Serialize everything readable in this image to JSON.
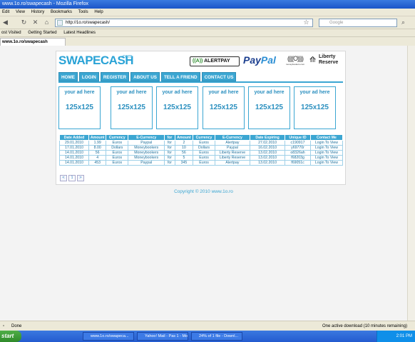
{
  "window": {
    "title": "www.1o.ro/swapecash - Mozilla Firefox"
  },
  "menu": [
    "Edit",
    "View",
    "History",
    "Bookmarks",
    "Tools",
    "Help"
  ],
  "toolbar": {
    "url": "http://1o.ro/swapecash/",
    "search_placeholder": "Google"
  },
  "bookmarks": [
    "ost Visited",
    "Getting Started",
    "Latest Headlines"
  ],
  "tab": {
    "label": "www.1o.ro/swapecash"
  },
  "page": {
    "logo": "SWAPECASH",
    "logo_suffix": ".com",
    "payments": {
      "alertpay_a": "((A))",
      "alertpay_b": "ALERTPAY",
      "paypal_a": "Pay",
      "paypal_b": "Pal",
      "moneybookers": "((((O))))",
      "moneybookers_sub": "moneybookers.com",
      "lr_icon": "⟰",
      "liberty_reserve": "Liberty Reserve"
    },
    "nav": [
      "HOME",
      "LOGIN",
      "REGISTER",
      "ABOUT US",
      "TELL A FRIEND",
      "CONTACT US"
    ],
    "ads": [
      {
        "line1": "your ad here",
        "line2": "125x125"
      },
      {
        "line1": "your ad here",
        "line2": "125x125"
      },
      {
        "line1": "your ad here",
        "line2": "125x125"
      },
      {
        "line1": "your ad here",
        "line2": "125x125"
      },
      {
        "line1": "your ad here",
        "line2": "125x125"
      },
      {
        "line1": "your ad here",
        "line2": "125x125"
      }
    ],
    "table": {
      "headers": [
        "Date Added",
        "Amount",
        "Currency",
        "E-Currency",
        "for",
        "Amount",
        "Currency",
        "E-Currency",
        "Date Expiring",
        "Unique ID",
        "Contact Me"
      ],
      "rows": [
        [
          "29.01.2010",
          "1.99",
          "Euros",
          "Paypal",
          "for",
          "2",
          "Euros",
          "Alertpay",
          "27.02.2010",
          "c190917",
          "Login To View"
        ],
        [
          "17.01.2010",
          "8.00",
          "Dollars",
          "Moneybookers",
          "for",
          "10",
          "Dollars",
          "Paypal",
          "16.02.2010",
          "y69770r",
          "Login To View"
        ],
        [
          "14.01.2010",
          "56",
          "Euros",
          "Moneybookers",
          "for",
          "56",
          "Euros",
          "Liberty Reserve",
          "13.02.2010",
          "o8326ah",
          "Login To View"
        ],
        [
          "14.01.2010",
          "4",
          "Euros",
          "Moneybookers",
          "for",
          "5",
          "Euros",
          "Liberty Reserve",
          "13.02.2010",
          "f68203g",
          "Login To View"
        ],
        [
          "14.01.2010",
          "453",
          "Euros",
          "Paypal",
          "for",
          "345",
          "Euros",
          "Alertpay",
          "13.02.2010",
          "f69051c",
          "Login To View"
        ]
      ]
    },
    "pager": [
      "<",
      "1",
      ">"
    ],
    "copyright": "Copyright © 2010 www.1o.ro"
  },
  "status": {
    "left": "Done",
    "right": "One active download (10 minutes remaining)"
  },
  "taskbar": {
    "start": "start",
    "items": [
      "www.1o.ro/swapeca...",
      "Yahoo! Mail - Pas 1 - Moz...",
      "24% of 1 file - Downl..."
    ],
    "clock": "2:01 PM"
  }
}
